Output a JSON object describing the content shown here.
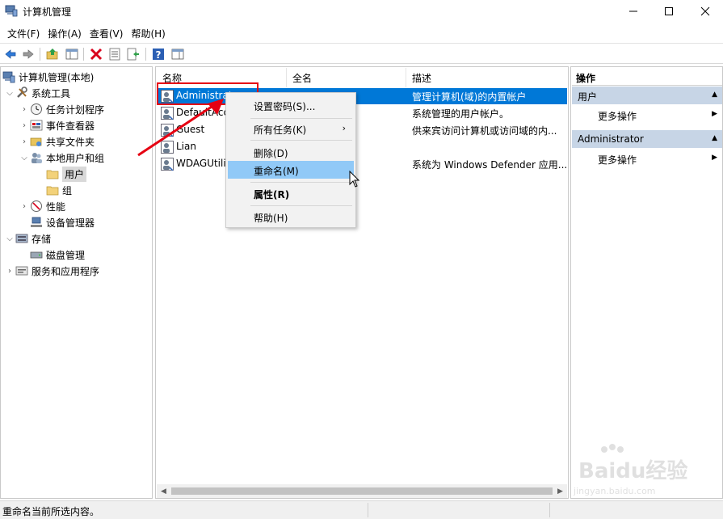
{
  "window": {
    "title": "计算机管理",
    "buttons": {
      "minimize": "—",
      "maximize": "☐",
      "close": "✕"
    }
  },
  "menubar": [
    {
      "label": "文件(F)"
    },
    {
      "label": "操作(A)"
    },
    {
      "label": "查看(V)"
    },
    {
      "label": "帮助(H)"
    }
  ],
  "toolbar": {
    "icons": [
      "back-arrow-icon",
      "forward-arrow-icon",
      "up-folder-icon",
      "show-hide-tree-icon",
      "delete-icon",
      "properties-icon",
      "export-list-icon",
      "help-icon",
      "show-action-pane-icon"
    ],
    "accent_delete": "#d9001b",
    "accent_help": "#2b5fb4"
  },
  "tree": {
    "root": "计算机管理(本地)",
    "system_tools": "系统工具",
    "task_scheduler": "任务计划程序",
    "event_viewer": "事件查看器",
    "shared_folders": "共享文件夹",
    "local_users_groups": "本地用户和组",
    "users": "用户",
    "groups": "组",
    "performance": "性能",
    "device_manager": "设备管理器",
    "storage": "存储",
    "disk_management": "磁盘管理",
    "services_apps": "服务和应用程序"
  },
  "list": {
    "columns": {
      "name": "名称",
      "fullname": "全名",
      "description": "描述"
    },
    "rows": [
      {
        "name": "Administrator",
        "fullname": "",
        "description": "管理计算机(域)的内置帐户"
      },
      {
        "name": "DefaultAccount",
        "fullname": "",
        "description": "系统管理的用户帐户。"
      },
      {
        "name": "Guest",
        "fullname": "",
        "description": "供来宾访问计算机或访问域的内..."
      },
      {
        "name": "Lian",
        "fullname": "",
        "description": ""
      },
      {
        "name": "WDAGUtilityAccount",
        "fullname": "",
        "description": "系统为 Windows Defender 应用..."
      }
    ],
    "selected_bg": "#0078d7"
  },
  "context_menu": {
    "set_password": "设置密码(S)...",
    "all_tasks": "所有任务(K)",
    "delete": "删除(D)",
    "rename": "重命名(M)",
    "properties": "属性(R)",
    "help": "帮助(H)",
    "hover_bg": "#91c9f7"
  },
  "actions": {
    "header": "操作",
    "section1": "用户",
    "more1": "更多操作",
    "section2": "Administrator",
    "more2": "更多操作",
    "section_bg": "#c7d5e6"
  },
  "statusbar": {
    "text": "重命名当前所选内容。"
  },
  "annotation": {
    "color": "#e60012"
  },
  "watermark": {
    "brand": "Baidu经验",
    "url": "jingyan.baidu.com"
  }
}
